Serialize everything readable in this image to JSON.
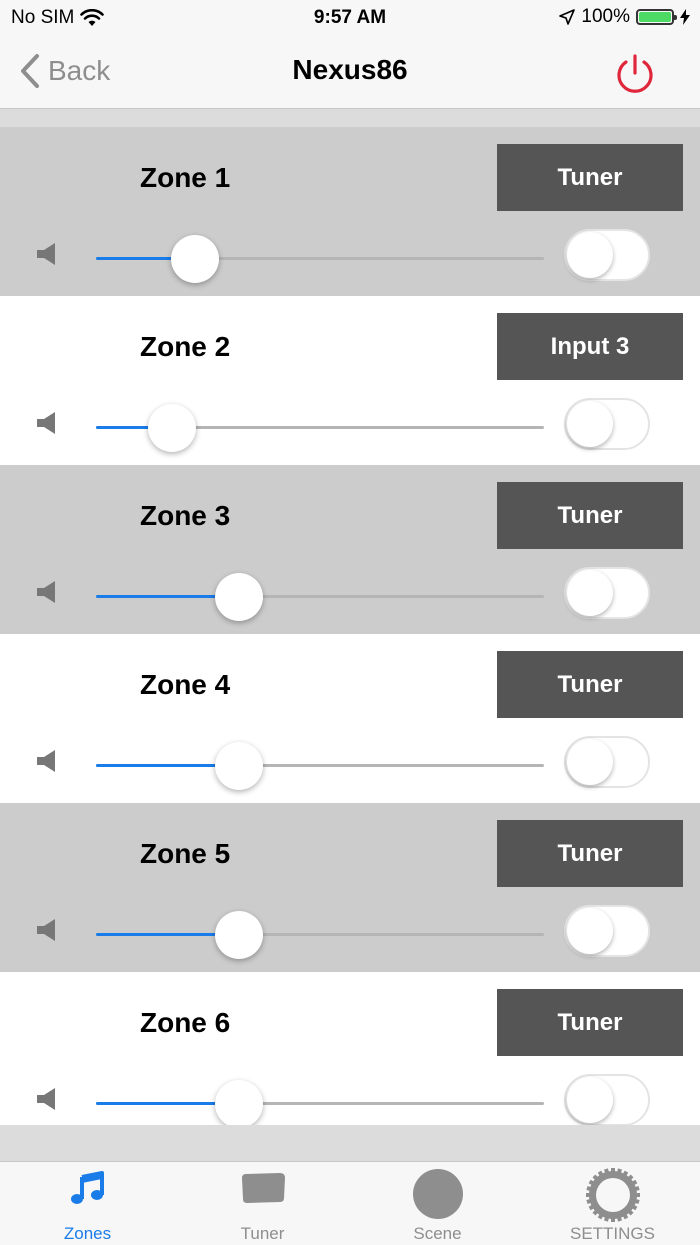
{
  "status": {
    "carrier": "No SIM",
    "time": "9:57 AM",
    "battery": "100%",
    "battery_level": 1.0
  },
  "nav": {
    "back_label": "Back",
    "title": "Nexus86"
  },
  "zones": [
    {
      "name": "Zone 1",
      "source": "Tuner",
      "volume": 0.22,
      "toggle_on": false
    },
    {
      "name": "Zone 2",
      "source": "Input 3",
      "volume": 0.17,
      "toggle_on": false
    },
    {
      "name": "Zone 3",
      "source": "Tuner",
      "volume": 0.32,
      "toggle_on": false
    },
    {
      "name": "Zone 4",
      "source": "Tuner",
      "volume": 0.32,
      "toggle_on": false
    },
    {
      "name": "Zone 5",
      "source": "Tuner",
      "volume": 0.32,
      "toggle_on": false
    },
    {
      "name": "Zone 6",
      "source": "Tuner",
      "volume": 0.32,
      "toggle_on": false
    }
  ],
  "tabs": [
    {
      "label": "Zones",
      "icon": "music-note-icon",
      "active": true
    },
    {
      "label": "Tuner",
      "icon": "tuner-icon",
      "active": false
    },
    {
      "label": "Scene",
      "icon": "scene-icon",
      "active": false
    },
    {
      "label": "SETTINGS",
      "icon": "gear-icon",
      "active": false
    }
  ],
  "colors": {
    "accent": "#1a7ce8",
    "power": "#e0263a",
    "source_button": "#555555",
    "shaded_row": "#cccccc"
  }
}
